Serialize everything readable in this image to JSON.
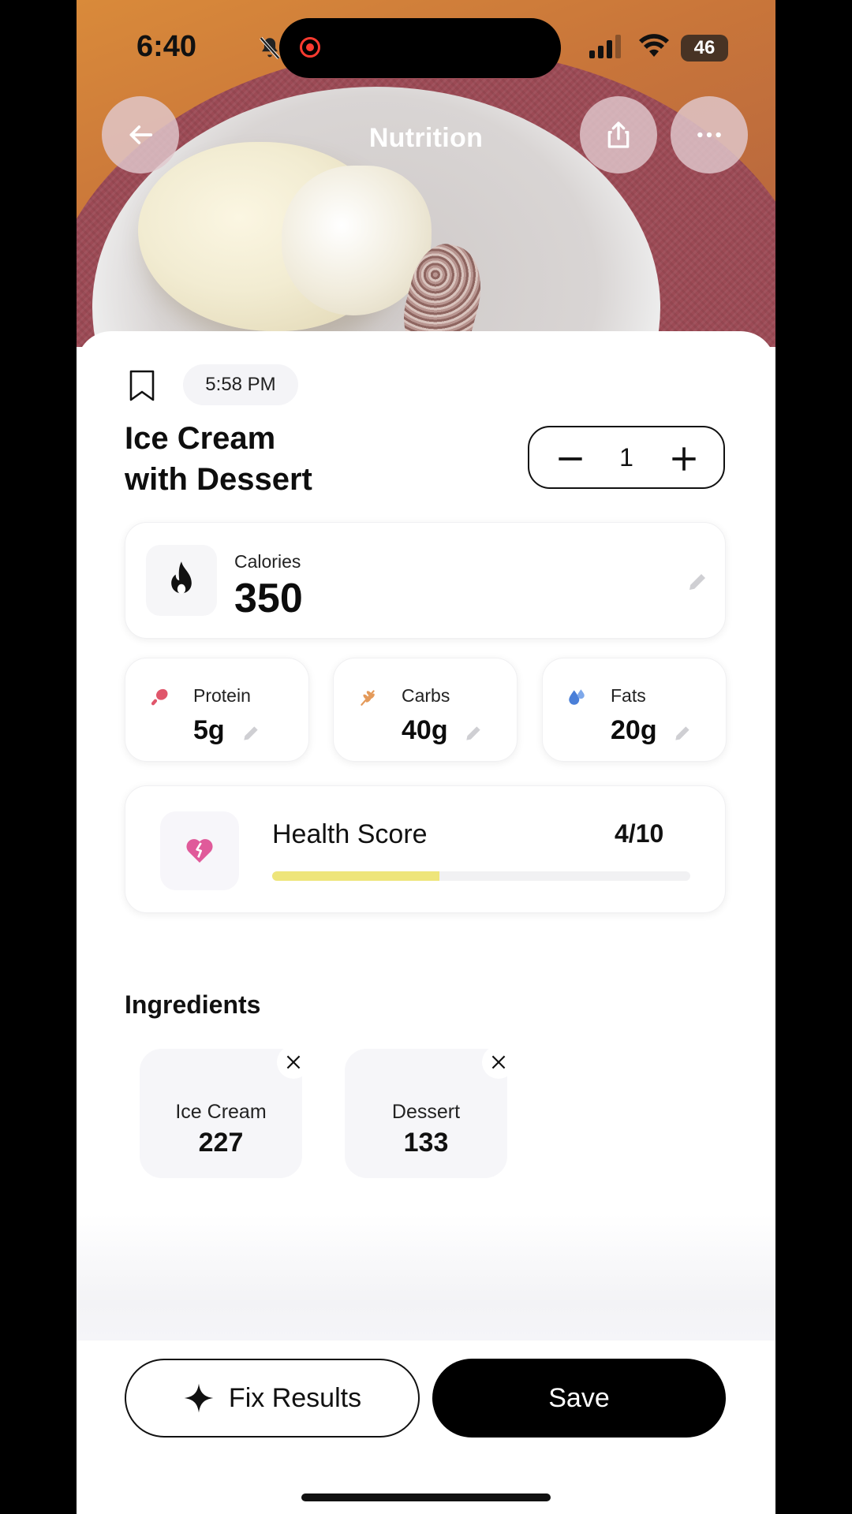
{
  "status_bar": {
    "time": "6:40",
    "battery": "46"
  },
  "nav": {
    "title": "Nutrition",
    "back_icon": "arrow-left-icon",
    "share_icon": "share-icon",
    "more_icon": "more-horizontal-icon"
  },
  "meal": {
    "time": "5:58 PM",
    "title_line1": "Ice Cream",
    "title_line2": "with Dessert",
    "servings": "1"
  },
  "calories": {
    "label": "Calories",
    "value": "350"
  },
  "macros": [
    {
      "label": "Protein",
      "value": "5g",
      "icon": "drumstick-icon",
      "color": "#e0566b"
    },
    {
      "label": "Carbs",
      "value": "40g",
      "icon": "wheat-icon",
      "color": "#e49a5a"
    },
    {
      "label": "Fats",
      "value": "20g",
      "icon": "droplets-icon",
      "color": "#4a7fd8"
    }
  ],
  "health_score": {
    "label": "Health Score",
    "value": "4/10",
    "fraction": 0.4,
    "bar_color": "#eee57a"
  },
  "ingredients": {
    "title": "Ingredients",
    "items": [
      {
        "name": "Ice Cream",
        "calories": "227"
      },
      {
        "name": "Dessert",
        "calories": "133"
      }
    ]
  },
  "actions": {
    "fix_label": "Fix Results",
    "save_label": "Save"
  }
}
